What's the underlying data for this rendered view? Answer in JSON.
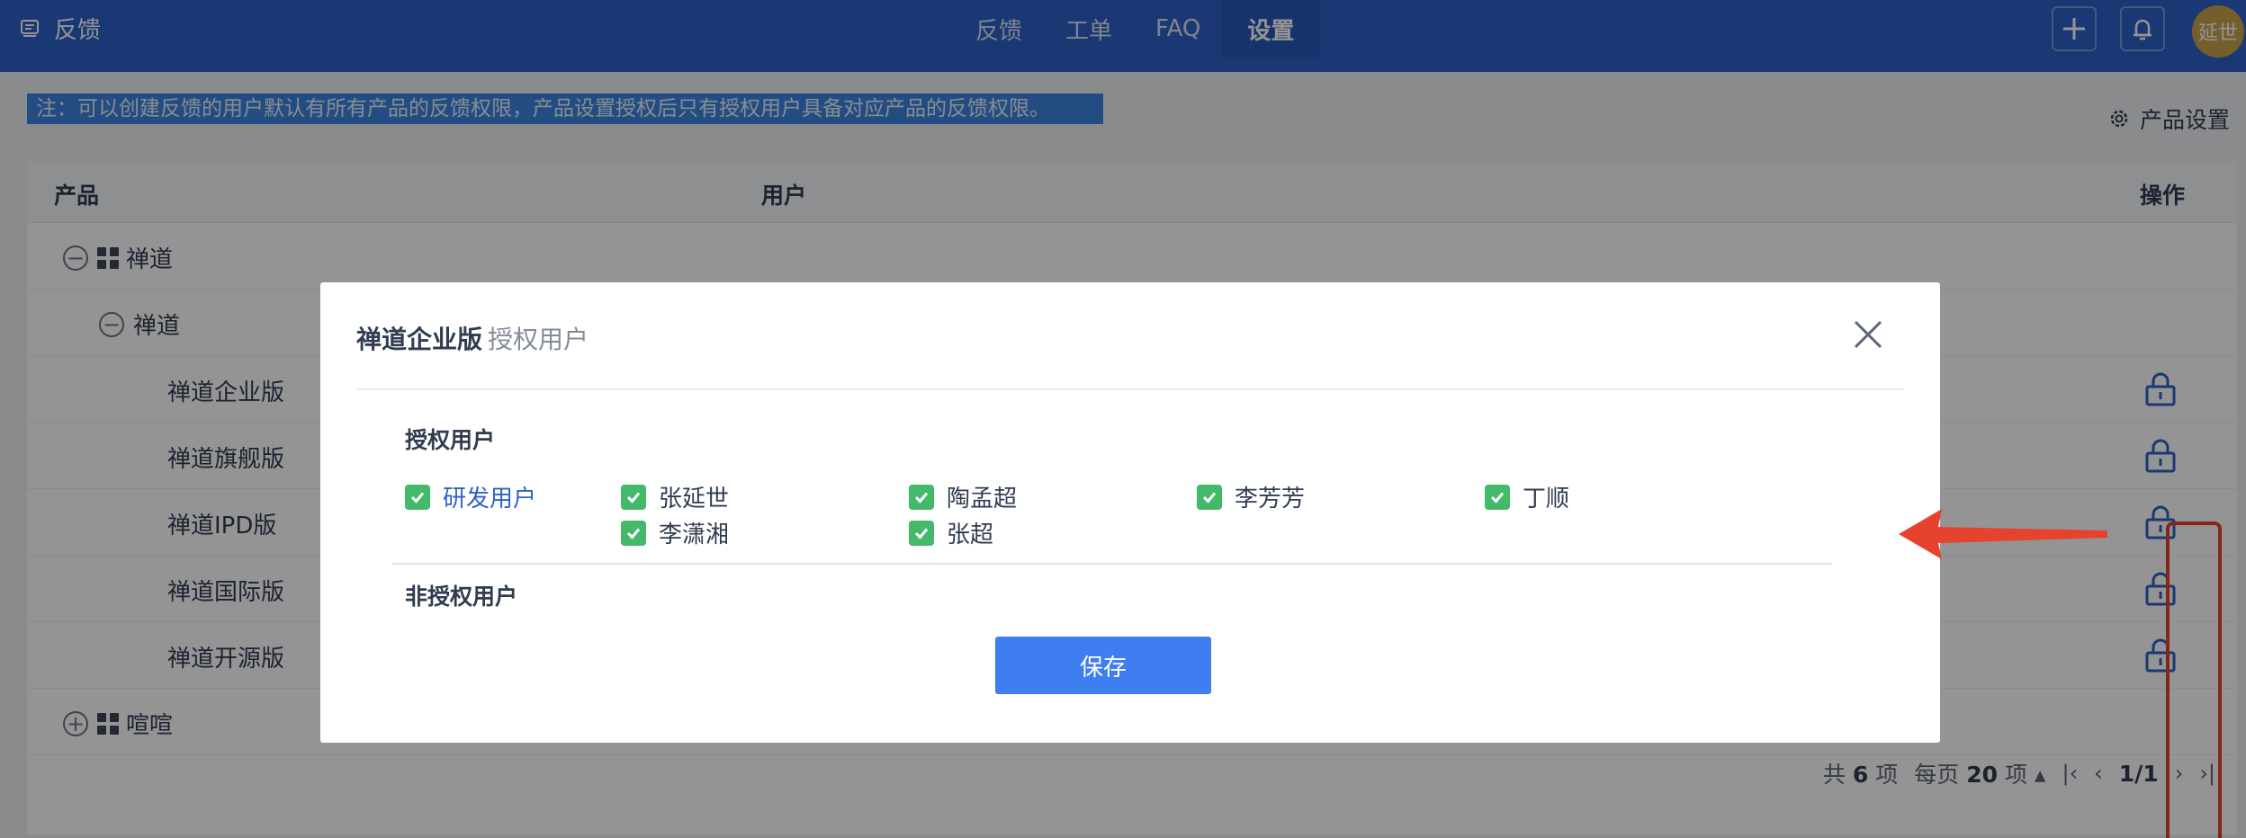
{
  "header": {
    "brand": "反馈",
    "nav": [
      "反馈",
      "工单",
      "FAQ",
      "设置"
    ],
    "active_nav": "设置",
    "avatar": "延世"
  },
  "note": "注：可以创建反馈的用户默认有所有产品的反馈权限，产品设置授权后只有授权用户具备对应产品的反馈权限。",
  "product_settings": "产品设置",
  "table": {
    "columns": {
      "product": "产品",
      "user": "用户",
      "action": "操作"
    },
    "rows": [
      {
        "name": "禅道",
        "toggle": "−"
      },
      {
        "name": "禅道",
        "toggle": "−"
      },
      {
        "name": "禅道企业版"
      },
      {
        "name": "禅道旗舰版"
      },
      {
        "name": "禅道IPD版"
      },
      {
        "name": "禅道国际版"
      },
      {
        "name": "禅道开源版"
      },
      {
        "name": "喧喧",
        "toggle": "+"
      }
    ]
  },
  "pager": {
    "total_prefix": "共",
    "total": "6",
    "total_suffix": "项",
    "per_page_prefix": "每页",
    "per_page": "20",
    "per_page_suffix": "项",
    "page": "1/1"
  },
  "modal": {
    "title": "禅道企业版",
    "subtitle": "授权用户",
    "authorized_label": "授权用户",
    "authorized": [
      {
        "name": "研发用户",
        "checked": true,
        "group": true
      },
      {
        "name": "张延世",
        "checked": true
      },
      {
        "name": "陶孟超",
        "checked": true
      },
      {
        "name": "李芳芳",
        "checked": true
      },
      {
        "name": "丁顺",
        "checked": true
      },
      {
        "name": "李潇湘",
        "checked": true
      },
      {
        "name": "张超",
        "checked": true
      }
    ],
    "unauthorized_label": "非授权用户",
    "save": "保存"
  },
  "colors": {
    "header_bg": "#2e62c9",
    "note_bg": "#3d86e0",
    "checkbox": "#43b96a",
    "primary_button": "#3f7ef0",
    "highlight": "#e6432f"
  },
  "icons": [
    "feedback-icon",
    "plus-icon",
    "bell-icon",
    "gear-icon",
    "lock-icon",
    "close-icon",
    "check-icon",
    "arrow-icon"
  ]
}
